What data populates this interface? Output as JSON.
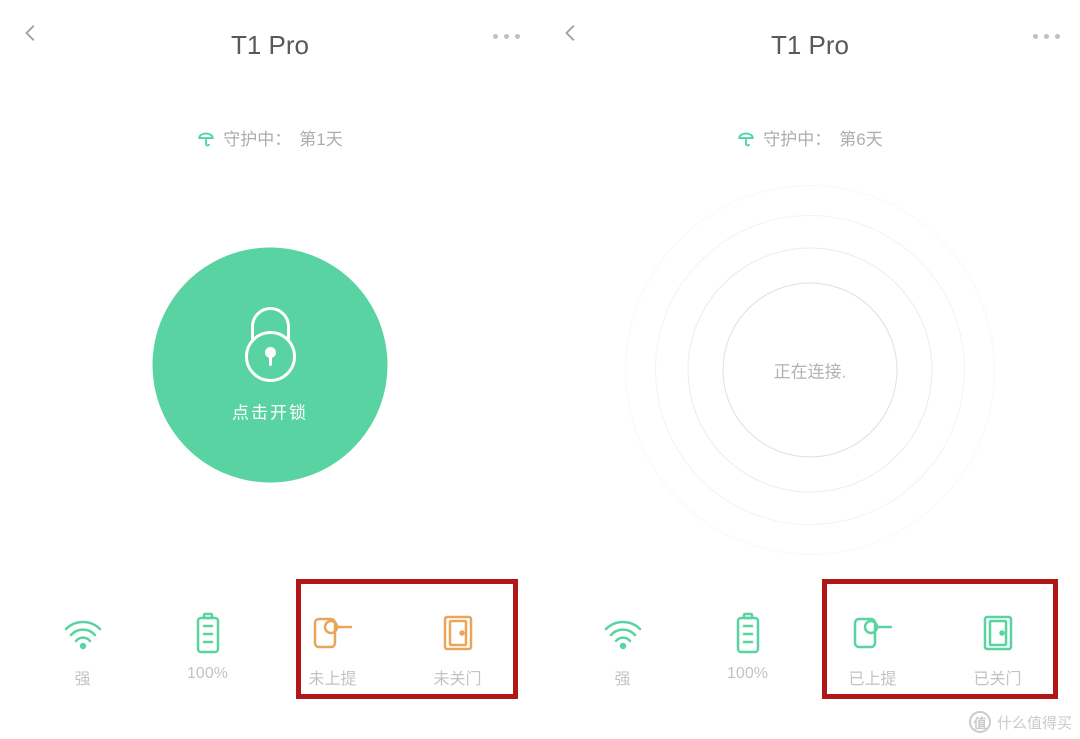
{
  "panes": [
    {
      "title": "T1 Pro",
      "guard_label": "守护中：",
      "guard_day": "第1天",
      "center": {
        "mode": "unlock",
        "unlock_label": "点击开锁"
      },
      "status": [
        {
          "icon": "wifi",
          "label": "强",
          "state": "ok"
        },
        {
          "icon": "battery",
          "label": "100%",
          "state": "ok"
        },
        {
          "icon": "handle",
          "label": "未上提",
          "state": "warn"
        },
        {
          "icon": "door",
          "label": "未关门",
          "state": "warn"
        }
      ]
    },
    {
      "title": "T1 Pro",
      "guard_label": "守护中：",
      "guard_day": "第6天",
      "center": {
        "mode": "connecting",
        "connecting_label": "正在连接."
      },
      "status": [
        {
          "icon": "wifi",
          "label": "强",
          "state": "ok"
        },
        {
          "icon": "battery",
          "label": "100%",
          "state": "ok"
        },
        {
          "icon": "handle",
          "label": "已上提",
          "state": "ok"
        },
        {
          "icon": "door",
          "label": "已关门",
          "state": "ok"
        }
      ]
    }
  ],
  "watermark": "什么值得买",
  "colors": {
    "accent_green": "#58d3a1",
    "warn_orange": "#e9a658",
    "highlight_red": "#b01818"
  }
}
